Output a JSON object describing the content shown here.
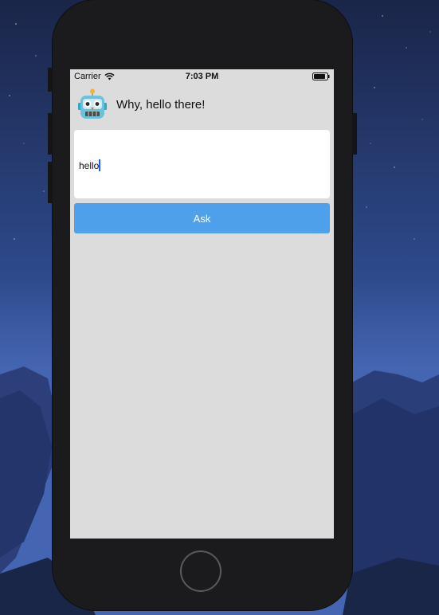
{
  "status_bar": {
    "carrier": "Carrier",
    "time": "7:03 PM"
  },
  "header": {
    "avatar_icon": "robot-icon",
    "greeting": "Why, hello there!"
  },
  "input": {
    "value": "hello"
  },
  "ask_button": {
    "label": "Ask",
    "color": "#4ea0ea"
  },
  "colors": {
    "screen_background": "#dcdcdc",
    "phone_body": "#1b1b1d"
  }
}
